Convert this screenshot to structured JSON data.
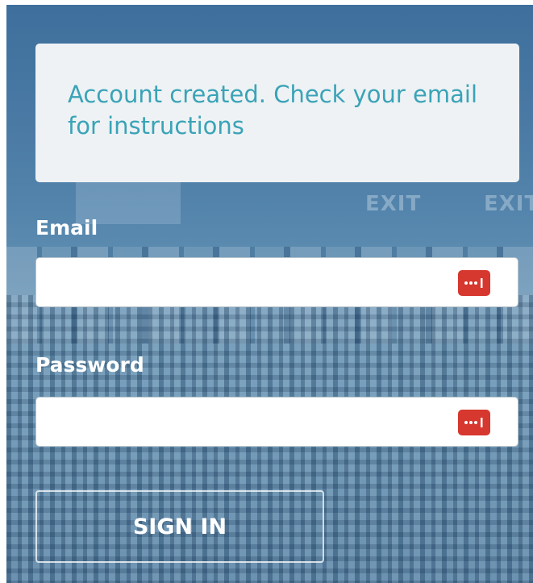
{
  "notice": {
    "message": "Account created. Check your email for instructions"
  },
  "form": {
    "email_label": "Email",
    "email_value": "",
    "password_label": "Password",
    "password_value": "",
    "password_manager_icon": "password-manager-icon",
    "submit_label": "SIGN IN"
  },
  "background": {
    "signs": [
      "EXIT",
      "EXIT"
    ]
  },
  "colors": {
    "notice_text": "#3aa3b7",
    "notice_bg": "#eef2f4",
    "overlay": "#2e6c98",
    "password_manager_icon": "#d6372e"
  }
}
